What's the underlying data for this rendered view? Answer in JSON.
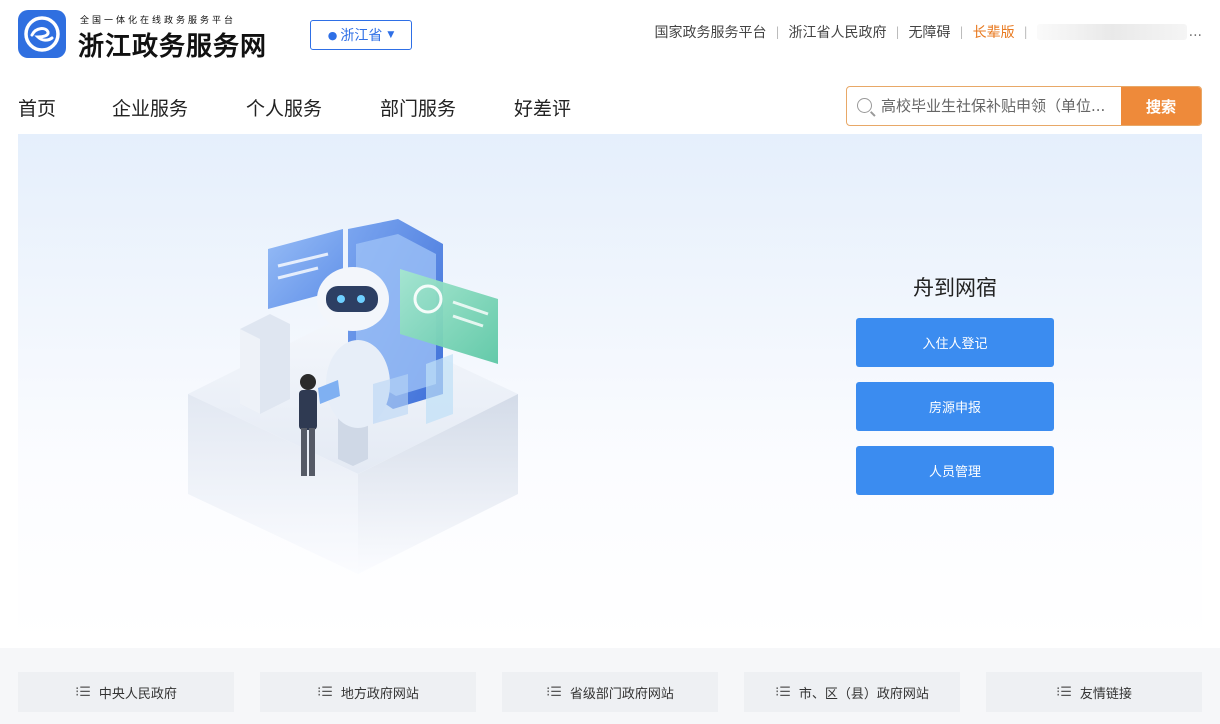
{
  "header": {
    "logo_subtitle": "全国一体化在线政务服务平台",
    "logo_title": "浙江政务服务网",
    "region": "浙江省",
    "links": [
      "国家政务服务平台",
      "浙江省人民政府",
      "无障碍",
      "长辈版"
    ],
    "ellipsis": "..."
  },
  "nav": {
    "items": [
      "首页",
      "企业服务",
      "个人服务",
      "部门服务",
      "好差评"
    ]
  },
  "search": {
    "placeholder": "高校毕业生社保补贴申领（单位...",
    "button": "搜索"
  },
  "panel": {
    "title": "舟到网宿",
    "buttons": [
      "入住人登记",
      "房源申报",
      "人员管理"
    ]
  },
  "footer": {
    "links": [
      "中央人民政府",
      "地方政府网站",
      "省级部门政府网站",
      "市、区（县）政府网站",
      "友情链接"
    ]
  },
  "colors": {
    "brand_blue": "#2f6fe0",
    "button_blue": "#3b8cf0",
    "search_orange": "#ee8a3a",
    "elder_orange": "#e8791f"
  }
}
